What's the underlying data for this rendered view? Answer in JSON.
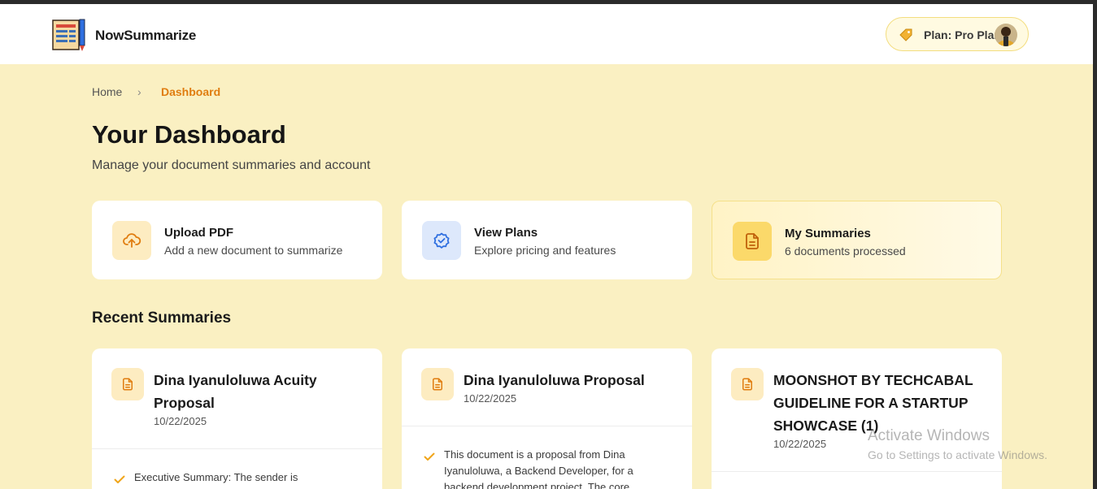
{
  "header": {
    "brand": "NowSummarize",
    "plan_label": "Plan: Pro Plan"
  },
  "breadcrumb": {
    "home": "Home",
    "separator": "›",
    "current": "Dashboard"
  },
  "page": {
    "title": "Your Dashboard",
    "subtitle": "Manage your document summaries and account"
  },
  "cards": [
    {
      "title": "Upload PDF",
      "desc": "Add a new document to summarize",
      "icon": "upload-cloud-icon"
    },
    {
      "title": "View Plans",
      "desc": "Explore pricing and features",
      "icon": "badge-check-icon"
    },
    {
      "title": "My Summaries",
      "desc": "6 documents processed",
      "icon": "document-icon"
    }
  ],
  "recent": {
    "title": "Recent Summaries",
    "items": [
      {
        "title": "Dina Iyanuloluwa Acuity Proposal",
        "date": "10/22/2025",
        "excerpt": "Executive Summary: The sender is"
      },
      {
        "title": "Dina Iyanuloluwa Proposal",
        "date": "10/22/2025",
        "excerpt": "This document is a proposal from Dina Iyanuloluwa, a Backend Developer, for a backend development project. The core"
      },
      {
        "title": "MOONSHOT BY TECHCABAL GUIDELINE FOR A STARTUP SHOWCASE (1)",
        "date": "10/22/2025",
        "excerpt": ""
      }
    ]
  },
  "watermark": {
    "line1": "Activate Windows",
    "line2": "Go to Settings to activate Windows."
  },
  "colors": {
    "background": "#faf0c2",
    "accent": "#e07d10",
    "blue": "#2f6fe0"
  }
}
